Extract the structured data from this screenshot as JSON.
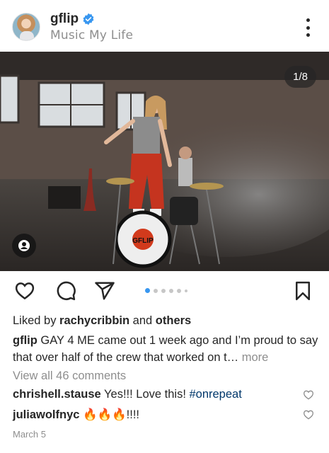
{
  "header": {
    "username": "gflip",
    "subtitle": "Music My Life",
    "verified_icon": "verified-badge-icon",
    "menu_icon": "more-vertical-icon"
  },
  "photo": {
    "counter": "1/8",
    "tag_icon": "user-tag-icon",
    "drum_logo": "GFLIP"
  },
  "actions": {
    "like_icon": "heart-icon",
    "comment_icon": "comment-icon",
    "share_icon": "send-icon",
    "save_icon": "bookmark-icon",
    "carousel_total": 8,
    "carousel_index": 1
  },
  "likes": {
    "prefix": "Liked by ",
    "user": "rachycribbin",
    "mid": " and ",
    "others": "others"
  },
  "caption": {
    "user": "gflip",
    "text": " GAY 4 ME came out 1 week ago and I’m proud to say that over half of the crew that worked on t…",
    "more": " more"
  },
  "view_all": "View all 46 comments",
  "comments": [
    {
      "user": "chrishell.stause",
      "text": " Yes!!! Love this! ",
      "hashtag": "#onrepeat"
    },
    {
      "user": "juliawolfnyc",
      "text": " 🔥🔥🔥!!!!"
    }
  ],
  "date": "March 5",
  "colors": {
    "accent_blue": "#3897f0",
    "hashtag": "#00376b",
    "secondary_text": "#8e8e8e"
  }
}
